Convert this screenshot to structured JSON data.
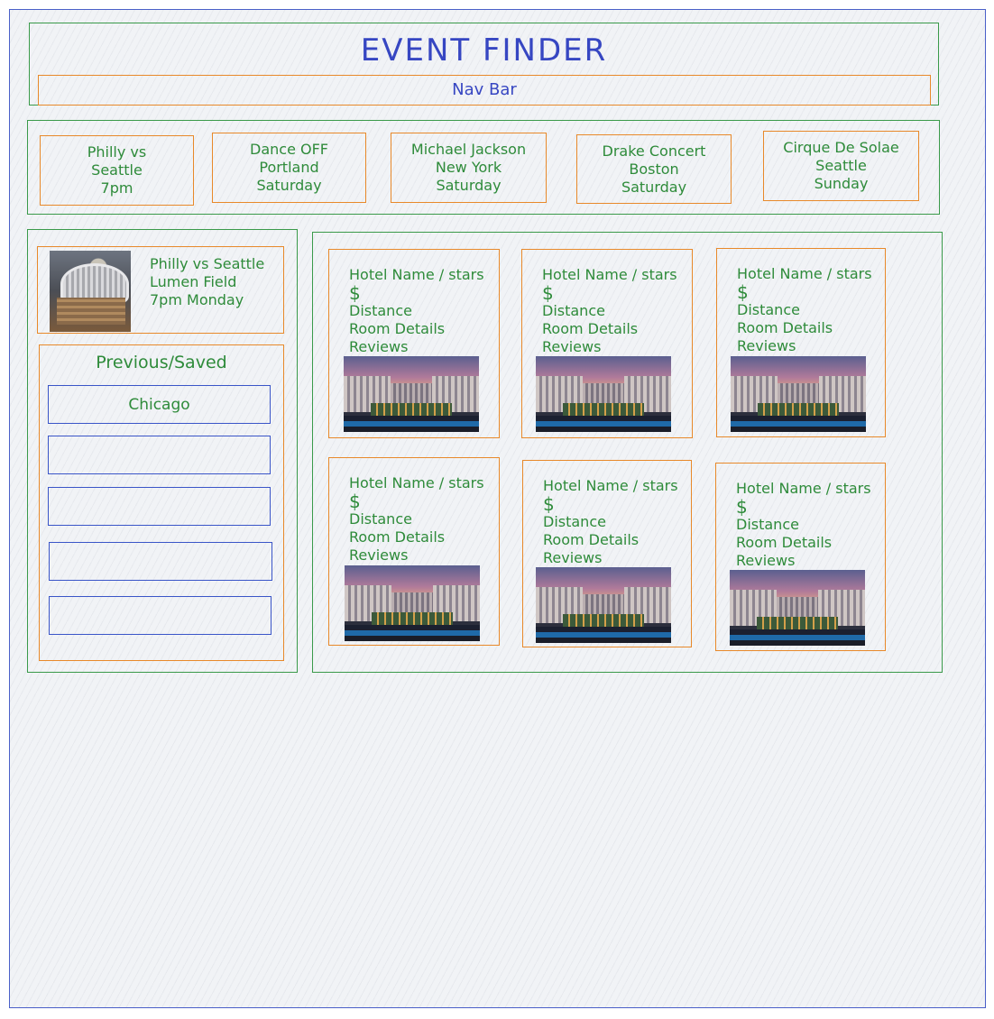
{
  "app": {
    "title": "EVENT FINDER",
    "nav_label": "Nav Bar"
  },
  "events": [
    {
      "line1": "Philly vs",
      "line2": "Seattle",
      "line3": "7pm"
    },
    {
      "line1": "Dance OFF",
      "line2": "Portland",
      "line3": "Saturday"
    },
    {
      "line1": "Michael Jackson",
      "line2": "New York",
      "line3": "Saturday"
    },
    {
      "line1": "Drake Concert",
      "line2": "Boston",
      "line3": "Saturday"
    },
    {
      "line1": "Cirque De Solae",
      "line2": "Seattle",
      "line3": "Sunday"
    }
  ],
  "current_event": {
    "line1": "Philly vs Seattle",
    "line2": "Lumen Field",
    "line3": "7pm Monday",
    "image_icon": "stadium-photo"
  },
  "saved": {
    "heading": "Previous/Saved",
    "items": [
      "Chicago",
      "",
      "",
      "",
      ""
    ]
  },
  "hotels": [
    {
      "name": "Hotel Name / stars",
      "price": "$",
      "distance": "Distance",
      "room": "Room Details",
      "reviews": "Reviews"
    },
    {
      "name": "Hotel Name / stars",
      "price": "$",
      "distance": "Distance",
      "room": "Room Details",
      "reviews": "Reviews"
    },
    {
      "name": "Hotel Name / stars",
      "price": "$",
      "distance": "Distance",
      "room": "Room Details",
      "reviews": "Reviews"
    },
    {
      "name": "Hotel Name / stars",
      "price": "$",
      "distance": "Distance",
      "room": "Room Details",
      "reviews": "Reviews"
    },
    {
      "name": "Hotel Name / stars",
      "price": "$",
      "distance": "Distance",
      "room": "Room Details",
      "reviews": "Reviews"
    },
    {
      "name": "Hotel Name / stars",
      "price": "$",
      "distance": "Distance",
      "room": "Room Details",
      "reviews": "Reviews"
    }
  ],
  "colors": {
    "outer_frame": "#4a5fc8",
    "section_border": "#3a9a4a",
    "card_border": "#e8892a",
    "list_border": "#3a55c8",
    "text_green": "#2e8b3a",
    "text_blue": "#3646c2"
  }
}
